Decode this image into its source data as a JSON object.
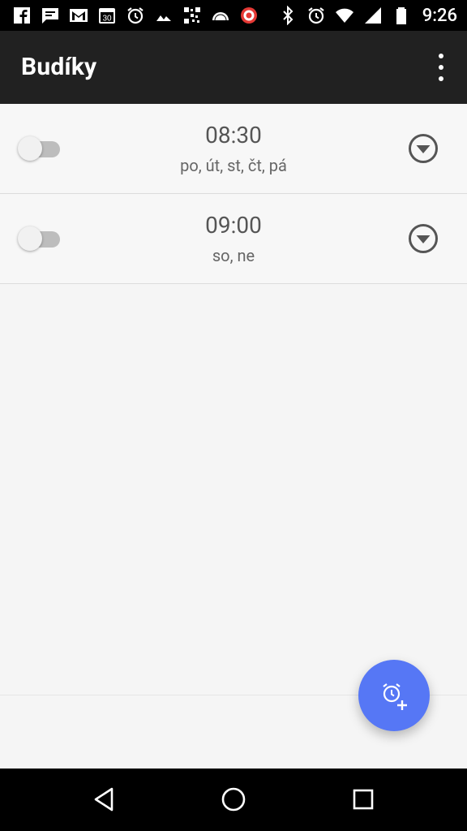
{
  "status_bar": {
    "time": "9:26",
    "icons_left": [
      "facebook-icon",
      "message-icon",
      "gmail-icon",
      "calendar-icon",
      "alarm-icon",
      "image-icon",
      "qr-icon",
      "dome-icon",
      "opera-icon"
    ],
    "calendar_day": "30",
    "icons_right": [
      "bluetooth-icon",
      "alarm-icon",
      "wifi-icon",
      "signal-icon",
      "battery-icon"
    ]
  },
  "app_bar": {
    "title": "Budíky"
  },
  "alarms": [
    {
      "time": "08:30",
      "days": "po, út, st, čt, pá",
      "enabled": false
    },
    {
      "time": "09:00",
      "days": "so, ne",
      "enabled": false
    }
  ],
  "fab": {
    "icon": "add-alarm-icon"
  },
  "colors": {
    "app_bar": "#212121",
    "background": "#f5f5f5",
    "fab": "#5677f5",
    "text_secondary": "#555555"
  },
  "nav_bar": {
    "icons": [
      "back-icon",
      "home-icon",
      "recents-icon"
    ]
  }
}
